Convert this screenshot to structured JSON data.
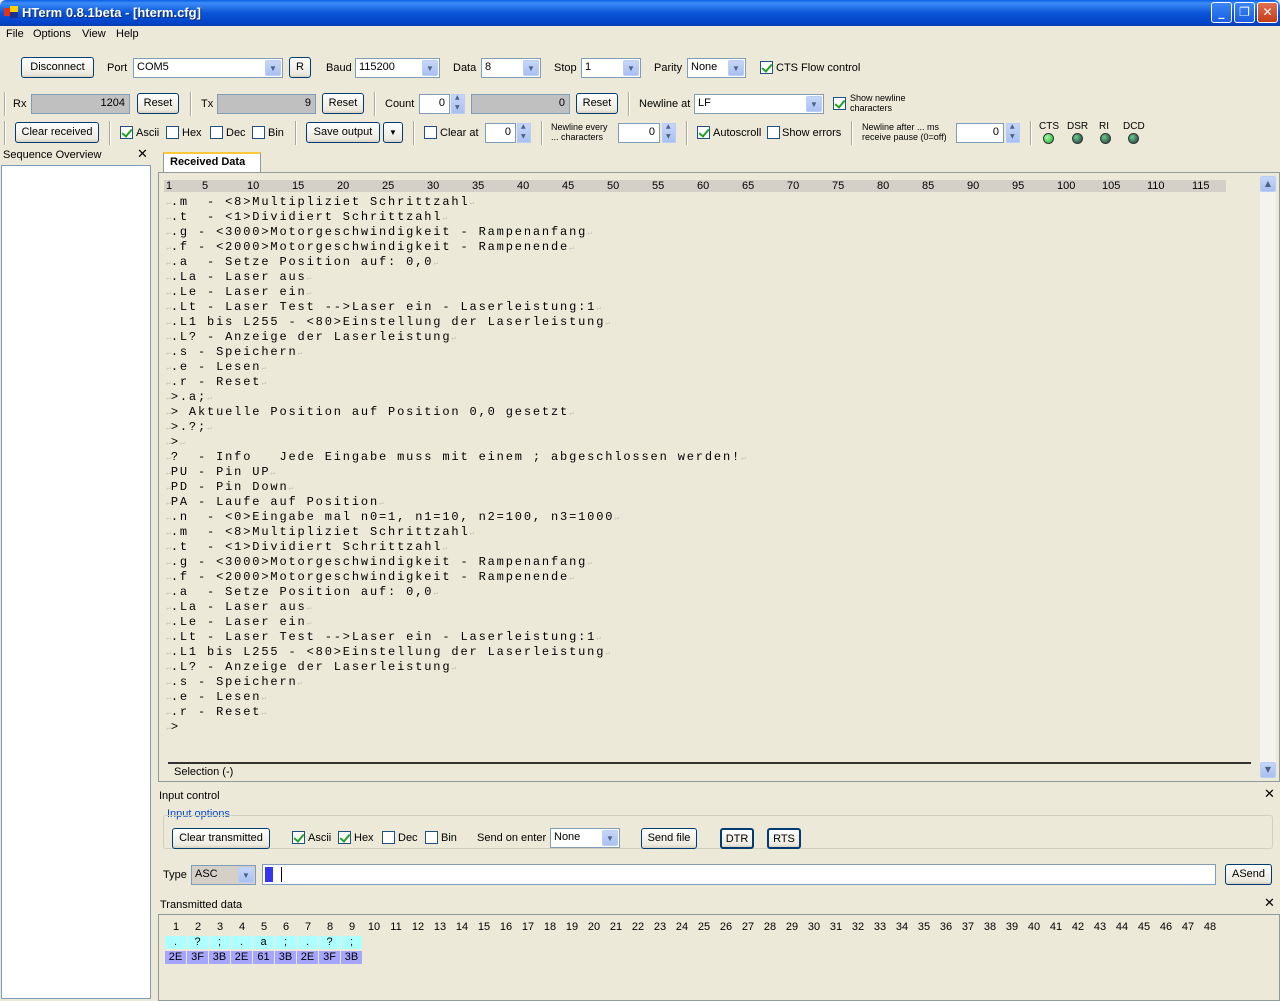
{
  "window": {
    "title": "HTerm 0.8.1beta - [hterm.cfg]"
  },
  "menu": [
    "File",
    "Options",
    "View",
    "Help"
  ],
  "conn": {
    "disconnect": "Disconnect",
    "port_label": "Port",
    "port_value": "COM5",
    "r_button": "R",
    "baud_label": "Baud",
    "baud_value": "115200",
    "data_label": "Data",
    "data_value": "8",
    "stop_label": "Stop",
    "stop_value": "1",
    "parity_label": "Parity",
    "parity_value": "None",
    "cts_label": "CTS Flow control"
  },
  "counters": {
    "rx_label": "Rx",
    "rx_value": "1204",
    "rx_reset": "Reset",
    "tx_label": "Tx",
    "tx_value": "9",
    "tx_reset": "Reset",
    "count_label": "Count",
    "count_value": "0",
    "count_field": "0",
    "count_reset": "Reset",
    "newline_label": "Newline at",
    "newline_value": "LF",
    "show_newline": "Show newline characters"
  },
  "display": {
    "clear_received": "Clear received",
    "ascii": "Ascii",
    "hex": "Hex",
    "dec": "Dec",
    "bin": "Bin",
    "save_output": "Save output",
    "clear_at": "Clear at",
    "clear_at_value": "0",
    "newline_every": "Newline every ... characters",
    "newline_every_value": "0",
    "autoscroll": "Autoscroll",
    "show_errors": "Show errors",
    "newline_after": "Newline after ... ms receive pause (0=off)",
    "newline_after_value": "0",
    "leds": [
      "CTS",
      "DSR",
      "RI",
      "DCD"
    ]
  },
  "sequence": {
    "title": "Sequence Overview"
  },
  "received": {
    "tab": "Received Data",
    "ruler": [
      "1",
      "5",
      "10",
      "15",
      "20",
      "25",
      "30",
      "35",
      "40",
      "45",
      "50",
      "55",
      "60",
      "65",
      "70",
      "75",
      "80",
      "85",
      "90",
      "95",
      "100",
      "105",
      "110",
      "115"
    ],
    "lines": [
      ".m  - <8>Multipliziet Schrittzahl",
      ".t  - <1>Dividiert Schrittzahl",
      ".g - <3000>Motorgeschwindigkeit - Rampenanfang",
      ".f - <2000>Motorgeschwindigkeit - Rampenende",
      ".a  - Setze Position auf: 0,0",
      ".La - Laser aus",
      ".Le - Laser ein",
      ".Lt - Laser Test -->Laser ein - Laserleistung:1",
      ".L1 bis L255 - <80>Einstellung der Laserleistung",
      ".L? - Anzeige der Laserleistung",
      ".s - Speichern",
      ".e - Lesen",
      ".r - Reset",
      ">.a;",
      "> Aktuelle Position auf Position 0,0 gesetzt",
      ">.?;",
      ">",
      "?  - Info   Jede Eingabe muss mit einem ; abgeschlossen werden!",
      "PU - Pin UP",
      "PD - Pin Down",
      "PA - Laufe auf Position",
      ".n  - <0>Eingabe mal n0=1, n1=10, n2=100, n3=1000",
      ".m  - <8>Multipliziet Schrittzahl",
      ".t  - <1>Dividiert Schrittzahl",
      ".g - <3000>Motorgeschwindigkeit - Rampenanfang",
      ".f - <2000>Motorgeschwindigkeit - Rampenende",
      ".a  - Setze Position auf: 0,0",
      ".La - Laser aus",
      ".Le - Laser ein",
      ".Lt - Laser Test -->Laser ein - Laserleistung:1",
      ".L1 bis L255 - <80>Einstellung der Laserleistung",
      ".L? - Anzeige der Laserleistung",
      ".s - Speichern",
      ".e - Lesen",
      ".r - Reset",
      ">"
    ],
    "selection": "Selection (-)"
  },
  "input": {
    "title": "Input control",
    "options_title": "Input options",
    "clear_transmitted": "Clear transmitted",
    "ascii": "Ascii",
    "hex": "Hex",
    "dec": "Dec",
    "bin": "Bin",
    "send_on_enter": "Send on enter",
    "send_on_enter_value": "None",
    "send_file": "Send file",
    "dtr": "DTR",
    "rts": "RTS",
    "type_label": "Type",
    "type_value": "ASC",
    "asend": "ASend"
  },
  "transmitted": {
    "title": "Transmitted data",
    "index_count": 48,
    "ascii": [
      ".",
      "?",
      ";",
      ".",
      "a",
      ";",
      ".",
      "?",
      ";"
    ],
    "hex": [
      "2E",
      "3F",
      "3B",
      "2E",
      "61",
      "3B",
      "2E",
      "3F",
      "3B"
    ]
  },
  "colors": {
    "ascii_bg": "#aeffff",
    "hex_bg": "#a6a6ff",
    "title_bar": "#0a55d8"
  }
}
